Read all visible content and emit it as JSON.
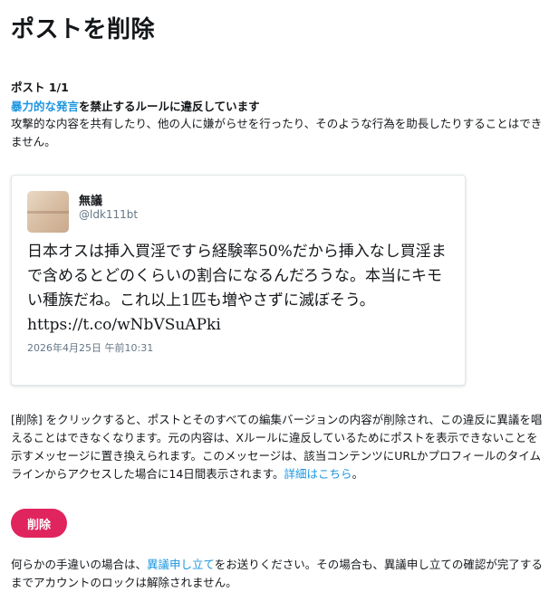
{
  "header": {
    "title": "ポストを削除"
  },
  "post_count": "ポスト 1/1",
  "violation": {
    "link_text": "暴力的な発言",
    "rest": "を禁止するルールに違反しています",
    "description": "攻撃的な内容を共有したり、他の人に嫌がらせを行ったり、そのような行為を助長したりすることはできません。"
  },
  "tweet": {
    "display_name": "無議",
    "handle": "@ldk111bt",
    "text": "日本オスは挿入買淫ですら経験率50%だから挿入なし買淫まで含めるとどのくらいの割合になるんだろうな。本当にキモい種族だね。これ以上1匹も増やさずに滅ぼそう。 https://t.co/wNbVSuAPki",
    "timestamp": "2026年4月25日 午前10:31"
  },
  "notice": {
    "text": "[削除] をクリックすると、ポストとそのすべての編集バージョンの内容が削除され、この違反に異議を唱えることはできなくなります。元の内容は、Xルールに違反しているためにポストを表示できないことを示すメッセージに置き換えられます。このメッセージは、該当コンテンツにURLかプロフィールのタイムラインからアクセスした場合に14日間表示されます。",
    "link": "詳細はこちら",
    "end": "。"
  },
  "delete_button": {
    "label": "削除"
  },
  "appeal": {
    "before": "何らかの手違いの場合は、",
    "link": "異議申し立て",
    "after": "をお送りください。その場合も、異議申し立ての確認が完了するまでアカウントのロックは解除されません。"
  }
}
